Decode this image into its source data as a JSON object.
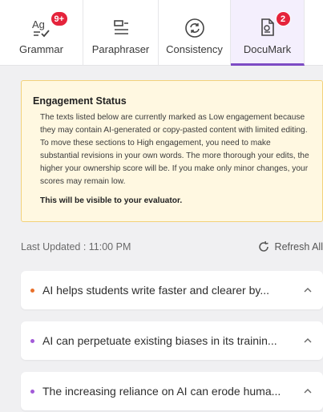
{
  "tabs": [
    {
      "label": "Grammar",
      "icon": "grammar-check-icon",
      "badge": "9+",
      "active": false
    },
    {
      "label": "Paraphraser",
      "icon": "paraphrase-lines-icon",
      "badge": null,
      "active": false
    },
    {
      "label": "Consistency",
      "icon": "consistency-circle-icon",
      "badge": null,
      "active": false
    },
    {
      "label": "DocuMark",
      "icon": "documark-document-icon",
      "badge": "2",
      "active": true
    }
  ],
  "engagement": {
    "title": "Engagement Status",
    "body": "The texts listed below are currently marked as Low engagement because they may contain AI-generated or copy-pasted content with limited editing. To move these sections to High engagement, you need to make substantial revisions in your own words. The more thorough your edits, the higher your ownership score will be. If you make only minor changes, your scores may remain low.",
    "footer": "This will be visible to your evaluator."
  },
  "status": {
    "last_updated": "Last Updated : 11:00 PM",
    "refresh_label": "Refresh All"
  },
  "items": [
    {
      "text": "AI helps students write faster and clearer by...",
      "dot_color": "#e8702a"
    },
    {
      "text": "AI can perpetuate existing biases in its trainin...",
      "dot_color": "#a25ad8"
    },
    {
      "text": "The increasing reliance on AI can erode huma...",
      "dot_color": "#a25ad8"
    }
  ],
  "colors": {
    "accent": "#7d4bc4",
    "badge": "#e5233b",
    "notice_bg": "#fff8e1",
    "notice_border": "#f3d27a"
  }
}
